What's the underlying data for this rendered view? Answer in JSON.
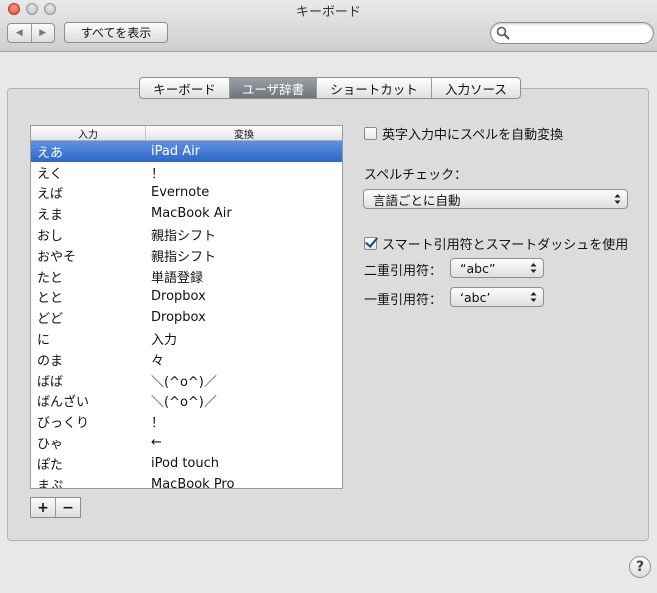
{
  "window": {
    "title": "キーボード"
  },
  "toolbar": {
    "back_glyph": "◀",
    "forward_glyph": "▶",
    "show_all_label": "すべてを表示",
    "search_placeholder": "",
    "search_value": ""
  },
  "tabs": [
    {
      "label": "キーボード",
      "active": false
    },
    {
      "label": "ユーザ辞書",
      "active": true
    },
    {
      "label": "ショートカット",
      "active": false
    },
    {
      "label": "入力ソース",
      "active": false
    }
  ],
  "dictionary": {
    "columns": {
      "input": "入力",
      "conversion": "変換"
    },
    "rows": [
      {
        "input": "えあ",
        "conversion": "iPad Air",
        "selected": true
      },
      {
        "input": "えく",
        "conversion": "！"
      },
      {
        "input": "えば",
        "conversion": "Evernote"
      },
      {
        "input": "えま",
        "conversion": "MacBook Air"
      },
      {
        "input": "おし",
        "conversion": "親指シフト"
      },
      {
        "input": "おやそ",
        "conversion": "親指シフト"
      },
      {
        "input": "たと",
        "conversion": "単語登録"
      },
      {
        "input": "とと",
        "conversion": "Dropbox"
      },
      {
        "input": "どど",
        "conversion": "Dropbox"
      },
      {
        "input": "に",
        "conversion": "入力"
      },
      {
        "input": "のま",
        "conversion": "々"
      },
      {
        "input": "ばば",
        "conversion": "＼(^o^)／"
      },
      {
        "input": "ばんざい",
        "conversion": "＼(^o^)／"
      },
      {
        "input": "びっくり",
        "conversion": "！"
      },
      {
        "input": "ひゃ",
        "conversion": "←"
      },
      {
        "input": "ぽた",
        "conversion": "iPod touch"
      },
      {
        "input": "まぷ",
        "conversion": "MacBook Pro"
      }
    ],
    "add_label": "+",
    "remove_label": "−"
  },
  "options": {
    "auto_spell": {
      "label": "英字入力中にスペルを自動変換",
      "checked": false
    },
    "spellcheck_label": "スペルチェック：",
    "spellcheck_value": "言語ごとに自動",
    "smart_quotes": {
      "label": "スマート引用符とスマートダッシュを使用",
      "checked": true
    },
    "double_quote_label": "二重引用符：",
    "double_quote_value": "“abc”",
    "single_quote_label": "一重引用符：",
    "single_quote_value": "‘abc’"
  },
  "help_label": "?",
  "colors": {
    "selection": "#3a73d0",
    "tab_active": "#7b8187",
    "close_light": "#e0443a"
  }
}
